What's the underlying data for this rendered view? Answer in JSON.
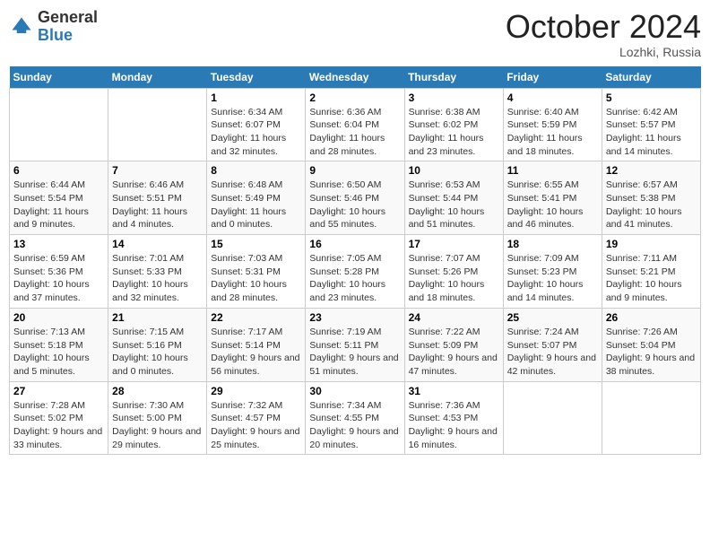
{
  "header": {
    "logo_line1": "General",
    "logo_line2": "Blue",
    "month": "October 2024",
    "location": "Lozhki, Russia"
  },
  "weekdays": [
    "Sunday",
    "Monday",
    "Tuesday",
    "Wednesday",
    "Thursday",
    "Friday",
    "Saturday"
  ],
  "weeks": [
    [
      {
        "day": "",
        "detail": ""
      },
      {
        "day": "",
        "detail": ""
      },
      {
        "day": "1",
        "detail": "Sunrise: 6:34 AM\nSunset: 6:07 PM\nDaylight: 11 hours and 32 minutes."
      },
      {
        "day": "2",
        "detail": "Sunrise: 6:36 AM\nSunset: 6:04 PM\nDaylight: 11 hours and 28 minutes."
      },
      {
        "day": "3",
        "detail": "Sunrise: 6:38 AM\nSunset: 6:02 PM\nDaylight: 11 hours and 23 minutes."
      },
      {
        "day": "4",
        "detail": "Sunrise: 6:40 AM\nSunset: 5:59 PM\nDaylight: 11 hours and 18 minutes."
      },
      {
        "day": "5",
        "detail": "Sunrise: 6:42 AM\nSunset: 5:57 PM\nDaylight: 11 hours and 14 minutes."
      }
    ],
    [
      {
        "day": "6",
        "detail": "Sunrise: 6:44 AM\nSunset: 5:54 PM\nDaylight: 11 hours and 9 minutes."
      },
      {
        "day": "7",
        "detail": "Sunrise: 6:46 AM\nSunset: 5:51 PM\nDaylight: 11 hours and 4 minutes."
      },
      {
        "day": "8",
        "detail": "Sunrise: 6:48 AM\nSunset: 5:49 PM\nDaylight: 11 hours and 0 minutes."
      },
      {
        "day": "9",
        "detail": "Sunrise: 6:50 AM\nSunset: 5:46 PM\nDaylight: 10 hours and 55 minutes."
      },
      {
        "day": "10",
        "detail": "Sunrise: 6:53 AM\nSunset: 5:44 PM\nDaylight: 10 hours and 51 minutes."
      },
      {
        "day": "11",
        "detail": "Sunrise: 6:55 AM\nSunset: 5:41 PM\nDaylight: 10 hours and 46 minutes."
      },
      {
        "day": "12",
        "detail": "Sunrise: 6:57 AM\nSunset: 5:38 PM\nDaylight: 10 hours and 41 minutes."
      }
    ],
    [
      {
        "day": "13",
        "detail": "Sunrise: 6:59 AM\nSunset: 5:36 PM\nDaylight: 10 hours and 37 minutes."
      },
      {
        "day": "14",
        "detail": "Sunrise: 7:01 AM\nSunset: 5:33 PM\nDaylight: 10 hours and 32 minutes."
      },
      {
        "day": "15",
        "detail": "Sunrise: 7:03 AM\nSunset: 5:31 PM\nDaylight: 10 hours and 28 minutes."
      },
      {
        "day": "16",
        "detail": "Sunrise: 7:05 AM\nSunset: 5:28 PM\nDaylight: 10 hours and 23 minutes."
      },
      {
        "day": "17",
        "detail": "Sunrise: 7:07 AM\nSunset: 5:26 PM\nDaylight: 10 hours and 18 minutes."
      },
      {
        "day": "18",
        "detail": "Sunrise: 7:09 AM\nSunset: 5:23 PM\nDaylight: 10 hours and 14 minutes."
      },
      {
        "day": "19",
        "detail": "Sunrise: 7:11 AM\nSunset: 5:21 PM\nDaylight: 10 hours and 9 minutes."
      }
    ],
    [
      {
        "day": "20",
        "detail": "Sunrise: 7:13 AM\nSunset: 5:18 PM\nDaylight: 10 hours and 5 minutes."
      },
      {
        "day": "21",
        "detail": "Sunrise: 7:15 AM\nSunset: 5:16 PM\nDaylight: 10 hours and 0 minutes."
      },
      {
        "day": "22",
        "detail": "Sunrise: 7:17 AM\nSunset: 5:14 PM\nDaylight: 9 hours and 56 minutes."
      },
      {
        "day": "23",
        "detail": "Sunrise: 7:19 AM\nSunset: 5:11 PM\nDaylight: 9 hours and 51 minutes."
      },
      {
        "day": "24",
        "detail": "Sunrise: 7:22 AM\nSunset: 5:09 PM\nDaylight: 9 hours and 47 minutes."
      },
      {
        "day": "25",
        "detail": "Sunrise: 7:24 AM\nSunset: 5:07 PM\nDaylight: 9 hours and 42 minutes."
      },
      {
        "day": "26",
        "detail": "Sunrise: 7:26 AM\nSunset: 5:04 PM\nDaylight: 9 hours and 38 minutes."
      }
    ],
    [
      {
        "day": "27",
        "detail": "Sunrise: 7:28 AM\nSunset: 5:02 PM\nDaylight: 9 hours and 33 minutes."
      },
      {
        "day": "28",
        "detail": "Sunrise: 7:30 AM\nSunset: 5:00 PM\nDaylight: 9 hours and 29 minutes."
      },
      {
        "day": "29",
        "detail": "Sunrise: 7:32 AM\nSunset: 4:57 PM\nDaylight: 9 hours and 25 minutes."
      },
      {
        "day": "30",
        "detail": "Sunrise: 7:34 AM\nSunset: 4:55 PM\nDaylight: 9 hours and 20 minutes."
      },
      {
        "day": "31",
        "detail": "Sunrise: 7:36 AM\nSunset: 4:53 PM\nDaylight: 9 hours and 16 minutes."
      },
      {
        "day": "",
        "detail": ""
      },
      {
        "day": "",
        "detail": ""
      }
    ]
  ]
}
